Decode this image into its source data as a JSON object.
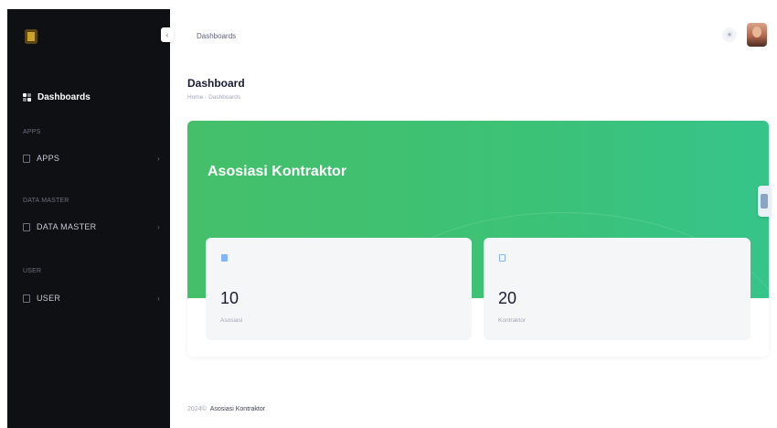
{
  "sidebar": {
    "active_item": "Dashboards",
    "sections": [
      {
        "label": "APPS",
        "item": "APPS"
      },
      {
        "label": "DATA MASTER",
        "item": "DATA MASTER"
      },
      {
        "label": "USER",
        "item": "USER"
      }
    ]
  },
  "header": {
    "title": "Dashboards",
    "collapse_icon": "chevron-left-icon",
    "theme_icon": "sun-icon"
  },
  "page": {
    "title": "Dashboard",
    "breadcrumb": "Home - Dashboards"
  },
  "hero": {
    "title": "Asosiasi Kontraktor",
    "color": "#45bf6a"
  },
  "stats": [
    {
      "icon": "list-icon",
      "value": "10",
      "label": "Asosiasi"
    },
    {
      "icon": "document-icon",
      "value": "20",
      "label": "Kontraktor"
    }
  ],
  "footer": {
    "year": "2024©",
    "brand": "Asosiasi Kontraktor"
  }
}
